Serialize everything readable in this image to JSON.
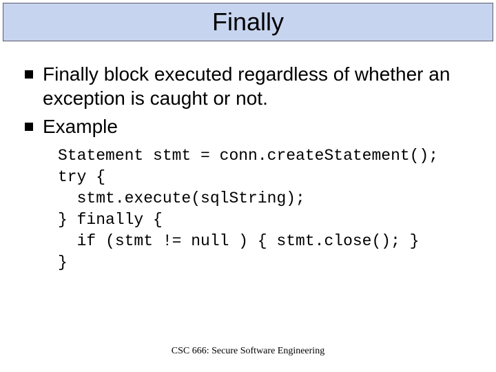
{
  "title": "Finally",
  "bullets": [
    "Finally block executed regardless of whether an exception is caught or not.",
    "Example"
  ],
  "code": {
    "l1": "Statement stmt = conn.createStatement();",
    "l2": "try {",
    "l3": "  stmt.execute(sqlString);",
    "l4": "} finally {",
    "l5": "  if (stmt != null ) { stmt.close(); }",
    "l6": "}"
  },
  "footer": "CSC 666: Secure Software Engineering"
}
